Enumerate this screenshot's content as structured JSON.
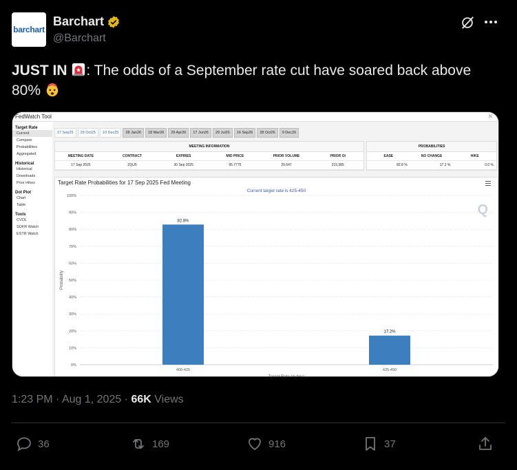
{
  "author": {
    "avatar_text": "barchart",
    "name": "Barchart",
    "handle": "@Barchart"
  },
  "tweet": {
    "lead": "JUST IN",
    "text_part1": ": The odds of a September rate cut have soared back above",
    "text_part2": "80%"
  },
  "fedwatch": {
    "window_title": "FedWatch Tool",
    "close_glyph": "✕",
    "sidebar": [
      {
        "group": "Target Rate",
        "items": [
          "Current",
          "Compare",
          "Probabilities",
          "Aggregated"
        ]
      },
      {
        "group": "Historical",
        "items": [
          "Historical",
          "Downloads",
          "Prior Hikes"
        ]
      },
      {
        "group": "Dot Plot",
        "items": [
          "Chart",
          "Table"
        ]
      },
      {
        "group": "Tools",
        "items": [
          "CVOL",
          "SOFR Watch",
          "ESTR Watch"
        ]
      }
    ],
    "tabs": [
      "17 Sep25",
      "29 Oct25",
      "10 Dec25",
      "28 Jan26",
      "18 Mar26",
      "29 Apr26",
      "17 Jun26",
      "29 Jul26",
      "16 Sep26",
      "28 Oct26",
      "9 Dec26"
    ],
    "meeting_info": {
      "title": "MEETING INFORMATION",
      "headers": [
        "MEETING DATE",
        "CONTRACT",
        "EXPIRES",
        "MID PRICE",
        "PRIOR VOLUME",
        "PRIOR OI"
      ],
      "values": [
        "17 Sep 2025",
        "ZQU5",
        "30 Sep 2025",
        "95.7775",
        "29,647",
        "215,385"
      ]
    },
    "probabilities": {
      "title": "PROBABILITIES",
      "headers": [
        "EASE",
        "NO CHANGE",
        "HIKE"
      ],
      "values": [
        "82.8 %",
        "17.2 %",
        "0.0 %"
      ]
    },
    "q_logo": "Q"
  },
  "chart_data": {
    "type": "bar",
    "title": "Target Rate Probabilities for 17 Sep 2025 Fed Meeting",
    "subtitle": "Current target rate is 425-450",
    "xlabel": "Target Rate (in bps)",
    "ylabel": "Probability",
    "categories": [
      "400-425",
      "425-450"
    ],
    "values": [
      82.8,
      17.2
    ],
    "data_labels": [
      "82.8%",
      "17.2%"
    ],
    "ylim": [
      0,
      100
    ],
    "yticks": [
      "0%",
      "10%",
      "20%",
      "30%",
      "40%",
      "50%",
      "60%",
      "70%",
      "80%",
      "90%",
      "100%"
    ],
    "grid": true,
    "bar_color": "#3d7ebf"
  },
  "meta": {
    "time": "1:23 PM",
    "date": "Aug 1, 2025",
    "views_count": "66K",
    "views_label": "Views"
  },
  "actions": {
    "replies": "36",
    "reposts": "169",
    "likes": "916",
    "bookmarks": "37"
  },
  "colors": {
    "background": "#000000",
    "text": "#e7e9ea",
    "muted": "#71767b",
    "verified": "#e2b719"
  }
}
